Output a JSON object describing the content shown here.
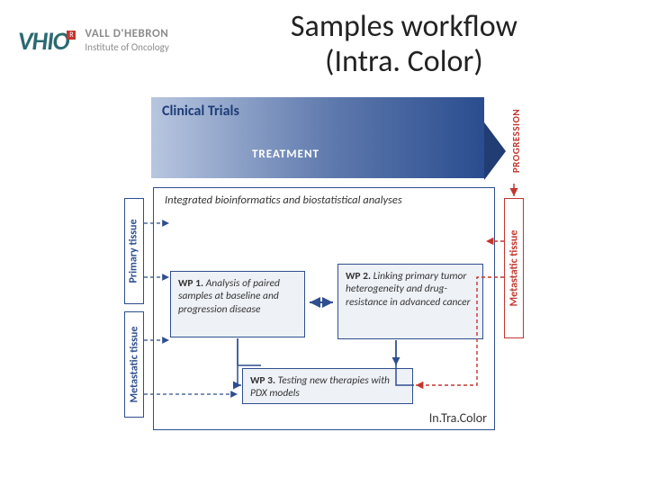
{
  "logo": {
    "mark": "VHIO",
    "badge": "R",
    "line1": "VALL D'HEBRON",
    "line2": "Institute of Oncology"
  },
  "title": {
    "line1": "Samples workflow",
    "line2": "(Intra. Color)"
  },
  "diagram": {
    "clinical_trials": "Clinical Trials",
    "treatment": "TREATMENT",
    "progression": "PROGRESSION",
    "primary_tissue": "Primary tissue",
    "metastatic_tissue": "Metastatic tissue",
    "integrated": "Integrated bioinformatics and biostatistical analyses",
    "wp1": {
      "tag": "WP 1.",
      "text": " Analysis of paired samples at baseline and progression disease"
    },
    "wp2": {
      "tag": "WP 2.",
      "text": " Linking primary tumor heterogeneity and drug-resistance in advanced cancer"
    },
    "wp3": {
      "tag": "WP 3.",
      "text": " Testing new therapies with PDX models"
    },
    "brand": "In.Tra.Color"
  }
}
